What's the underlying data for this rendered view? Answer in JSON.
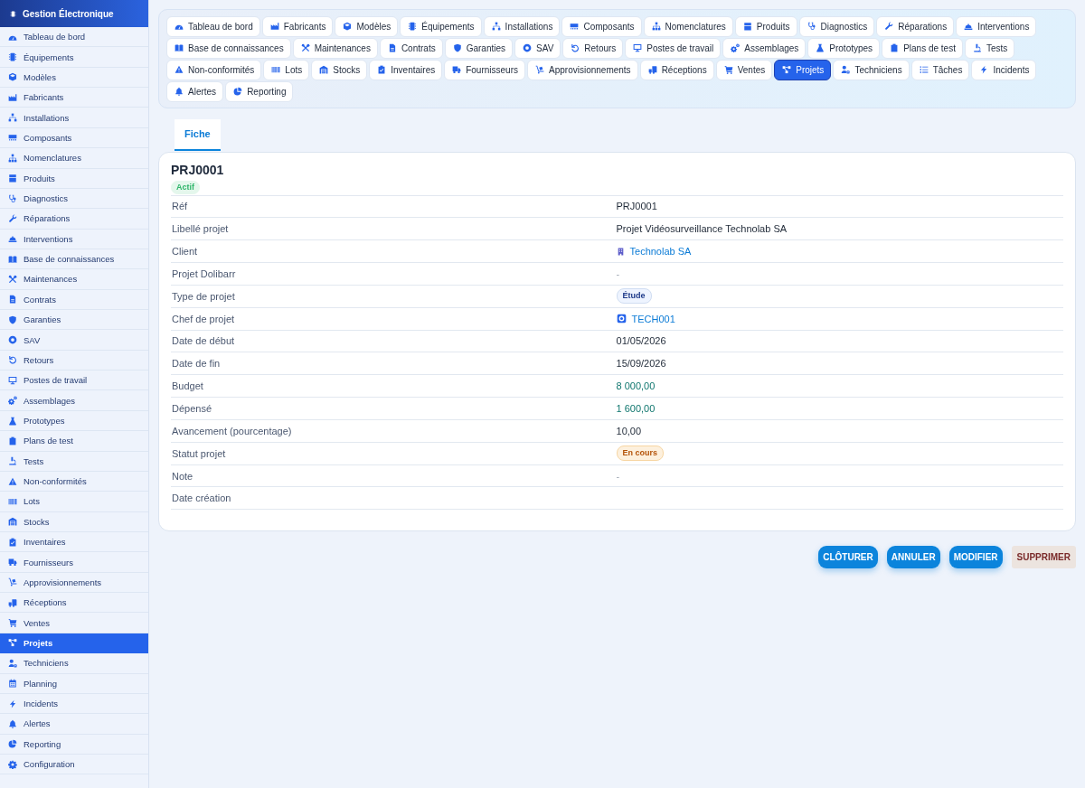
{
  "app": {
    "title": "Gestion Électronique"
  },
  "sidebar": {
    "items": [
      {
        "label": "Tableau de bord",
        "selected": false
      },
      {
        "label": "Équipements",
        "selected": false
      },
      {
        "label": "Modèles",
        "selected": false
      },
      {
        "label": "Fabricants",
        "selected": false
      },
      {
        "label": "Installations",
        "selected": false
      },
      {
        "label": "Composants",
        "selected": false
      },
      {
        "label": "Nomenclatures",
        "selected": false
      },
      {
        "label": "Produits",
        "selected": false
      },
      {
        "label": "Diagnostics",
        "selected": false
      },
      {
        "label": "Réparations",
        "selected": false
      },
      {
        "label": "Interventions",
        "selected": false
      },
      {
        "label": "Base de connaissances",
        "selected": false
      },
      {
        "label": "Maintenances",
        "selected": false
      },
      {
        "label": "Contrats",
        "selected": false
      },
      {
        "label": "Garanties",
        "selected": false
      },
      {
        "label": "SAV",
        "selected": false
      },
      {
        "label": "Retours",
        "selected": false
      },
      {
        "label": "Postes de travail",
        "selected": false
      },
      {
        "label": "Assemblages",
        "selected": false
      },
      {
        "label": "Prototypes",
        "selected": false
      },
      {
        "label": "Plans de test",
        "selected": false
      },
      {
        "label": "Tests",
        "selected": false
      },
      {
        "label": "Non-conformités",
        "selected": false
      },
      {
        "label": "Lots",
        "selected": false
      },
      {
        "label": "Stocks",
        "selected": false
      },
      {
        "label": "Inventaires",
        "selected": false
      },
      {
        "label": "Fournisseurs",
        "selected": false
      },
      {
        "label": "Approvisionnements",
        "selected": false
      },
      {
        "label": "Réceptions",
        "selected": false
      },
      {
        "label": "Ventes",
        "selected": false
      },
      {
        "label": "Projets",
        "selected": true
      },
      {
        "label": "Techniciens",
        "selected": false
      },
      {
        "label": "Planning",
        "selected": false
      },
      {
        "label": "Incidents",
        "selected": false
      },
      {
        "label": "Alertes",
        "selected": false
      },
      {
        "label": "Reporting",
        "selected": false
      },
      {
        "label": "Configuration",
        "selected": false
      }
    ]
  },
  "module_tabs": [
    {
      "label": "Tableau de bord",
      "selected": false
    },
    {
      "label": "Fabricants",
      "selected": false
    },
    {
      "label": "Modèles",
      "selected": false
    },
    {
      "label": "Équipements",
      "selected": false
    },
    {
      "label": "Installations",
      "selected": false
    },
    {
      "label": "Composants",
      "selected": false
    },
    {
      "label": "Nomenclatures",
      "selected": false
    },
    {
      "label": "Produits",
      "selected": false
    },
    {
      "label": "Diagnostics",
      "selected": false
    },
    {
      "label": "Réparations",
      "selected": false
    },
    {
      "label": "Interventions",
      "selected": false
    },
    {
      "label": "Base de connaissances",
      "selected": false
    },
    {
      "label": "Maintenances",
      "selected": false
    },
    {
      "label": "Contrats",
      "selected": false
    },
    {
      "label": "Garanties",
      "selected": false
    },
    {
      "label": "SAV",
      "selected": false
    },
    {
      "label": "Retours",
      "selected": false
    },
    {
      "label": "Postes de travail",
      "selected": false
    },
    {
      "label": "Assemblages",
      "selected": false
    },
    {
      "label": "Prototypes",
      "selected": false
    },
    {
      "label": "Plans de test",
      "selected": false
    },
    {
      "label": "Tests",
      "selected": false
    },
    {
      "label": "Non-conformités",
      "selected": false
    },
    {
      "label": "Lots",
      "selected": false
    },
    {
      "label": "Stocks",
      "selected": false
    },
    {
      "label": "Inventaires",
      "selected": false
    },
    {
      "label": "Fournisseurs",
      "selected": false
    },
    {
      "label": "Approvisionnements",
      "selected": false
    },
    {
      "label": "Réceptions",
      "selected": false
    },
    {
      "label": "Ventes",
      "selected": false
    },
    {
      "label": "Projets",
      "selected": true
    },
    {
      "label": "Techniciens",
      "selected": false
    },
    {
      "label": "Tâches",
      "selected": false
    },
    {
      "label": "Incidents",
      "selected": false
    },
    {
      "label": "Alertes",
      "selected": false
    },
    {
      "label": "Reporting",
      "selected": false
    }
  ],
  "detail_tabs": [
    {
      "label": "Fiche",
      "selected": true
    }
  ],
  "record": {
    "title": "PRJ0001",
    "status": "Actif",
    "fields": [
      {
        "label": "Réf",
        "kind": "text",
        "value": "PRJ0001"
      },
      {
        "label": "Libellé projet",
        "kind": "text",
        "value": "Projet Vidéosurveillance Technolab SA"
      },
      {
        "label": "Client",
        "kind": "company",
        "value": "Technolab SA"
      },
      {
        "label": "Projet Dolibarr",
        "kind": "muted",
        "value": "-"
      },
      {
        "label": "Type de projet",
        "kind": "tag",
        "value": "Étude"
      },
      {
        "label": "Chef de projet",
        "kind": "person",
        "value": "TECH001"
      },
      {
        "label": "Date de début",
        "kind": "text",
        "value": "01/05/2026"
      },
      {
        "label": "Date de fin",
        "kind": "text",
        "value": "15/09/2026"
      },
      {
        "label": "Budget",
        "kind": "amount",
        "value": "8 000,00"
      },
      {
        "label": "Dépensé",
        "kind": "amount",
        "value": "1 600,00"
      },
      {
        "label": "Avancement (pourcentage)",
        "kind": "text",
        "value": "10,00"
      },
      {
        "label": "Statut projet",
        "kind": "status",
        "value": "En cours"
      },
      {
        "label": "Note",
        "kind": "muted",
        "value": "-"
      },
      {
        "label": "Date création"
      }
    ]
  },
  "actions": [
    {
      "label": "CLÔTURER",
      "kind": "primary"
    },
    {
      "label": "ANNULER",
      "kind": "primary"
    },
    {
      "label": "MODIFIER",
      "kind": "primary"
    },
    {
      "label": "SUPPRIMER",
      "kind": "danger"
    }
  ]
}
